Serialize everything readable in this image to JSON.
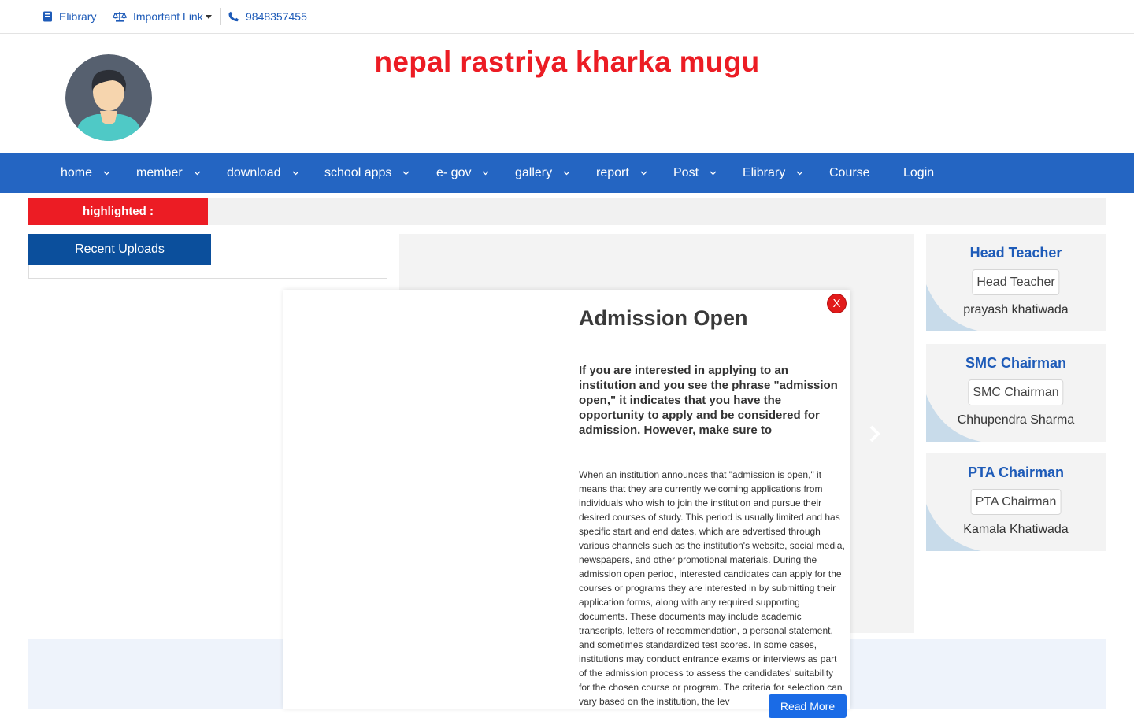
{
  "topbar": {
    "elibrary": "Elibrary",
    "important_link": "Important Link",
    "phone": "9848357455"
  },
  "header": {
    "site_title": "nepal rastriya kharka mugu"
  },
  "nav": {
    "items": [
      "home",
      "member",
      "download",
      "school apps",
      "e- gov",
      "gallery",
      "report",
      "Post",
      "Elibrary",
      "Course",
      "Login"
    ]
  },
  "highlight": {
    "label": "highlighted :"
  },
  "recent_uploads": {
    "title": "Recent Uploads"
  },
  "staff": [
    {
      "role": "Head Teacher",
      "photo_alt": "Head Teacher",
      "name": "prayash khatiwada"
    },
    {
      "role": "SMC Chairman",
      "photo_alt": "SMC Chairman",
      "name": "Chhupendra Sharma"
    },
    {
      "role": "PTA Chairman",
      "photo_alt": "PTA Chairman",
      "name": "Kamala Khatiwada"
    }
  ],
  "modal": {
    "close": "X",
    "title": "Admission Open",
    "lead": "If you are interested in applying to an institution and you see the phrase \"admission open,\" it indicates that you have the opportunity to apply and be considered for admission. However, make sure to",
    "body": "When an institution announces that \"admission is open,\" it means that they are currently welcoming applications from individuals who wish to join the institution and pursue their desired courses of study. This period is usually limited and has specific start and end dates, which are advertised through various channels such as the institution's website, social media, newspapers, and other promotional materials. During the admission open period, interested candidates can apply for the courses or programs they are interested in by submitting their application forms, along with any required supporting documents. These documents may include academic transcripts, letters of recommendation, a personal statement, and sometimes standardized test scores. In some cases, institutions may conduct entrance exams or interviews as part of the admission process to assess the candidates' suitability for the chosen course or program. The criteria for selection can vary based on the institution, the lev",
    "read_more": "Read More"
  },
  "colors": {
    "brand_blue": "#2465c2",
    "dark_blue": "#0b4f9c",
    "accent_red": "#ec1c24",
    "link_blue": "#1e5bb8"
  }
}
